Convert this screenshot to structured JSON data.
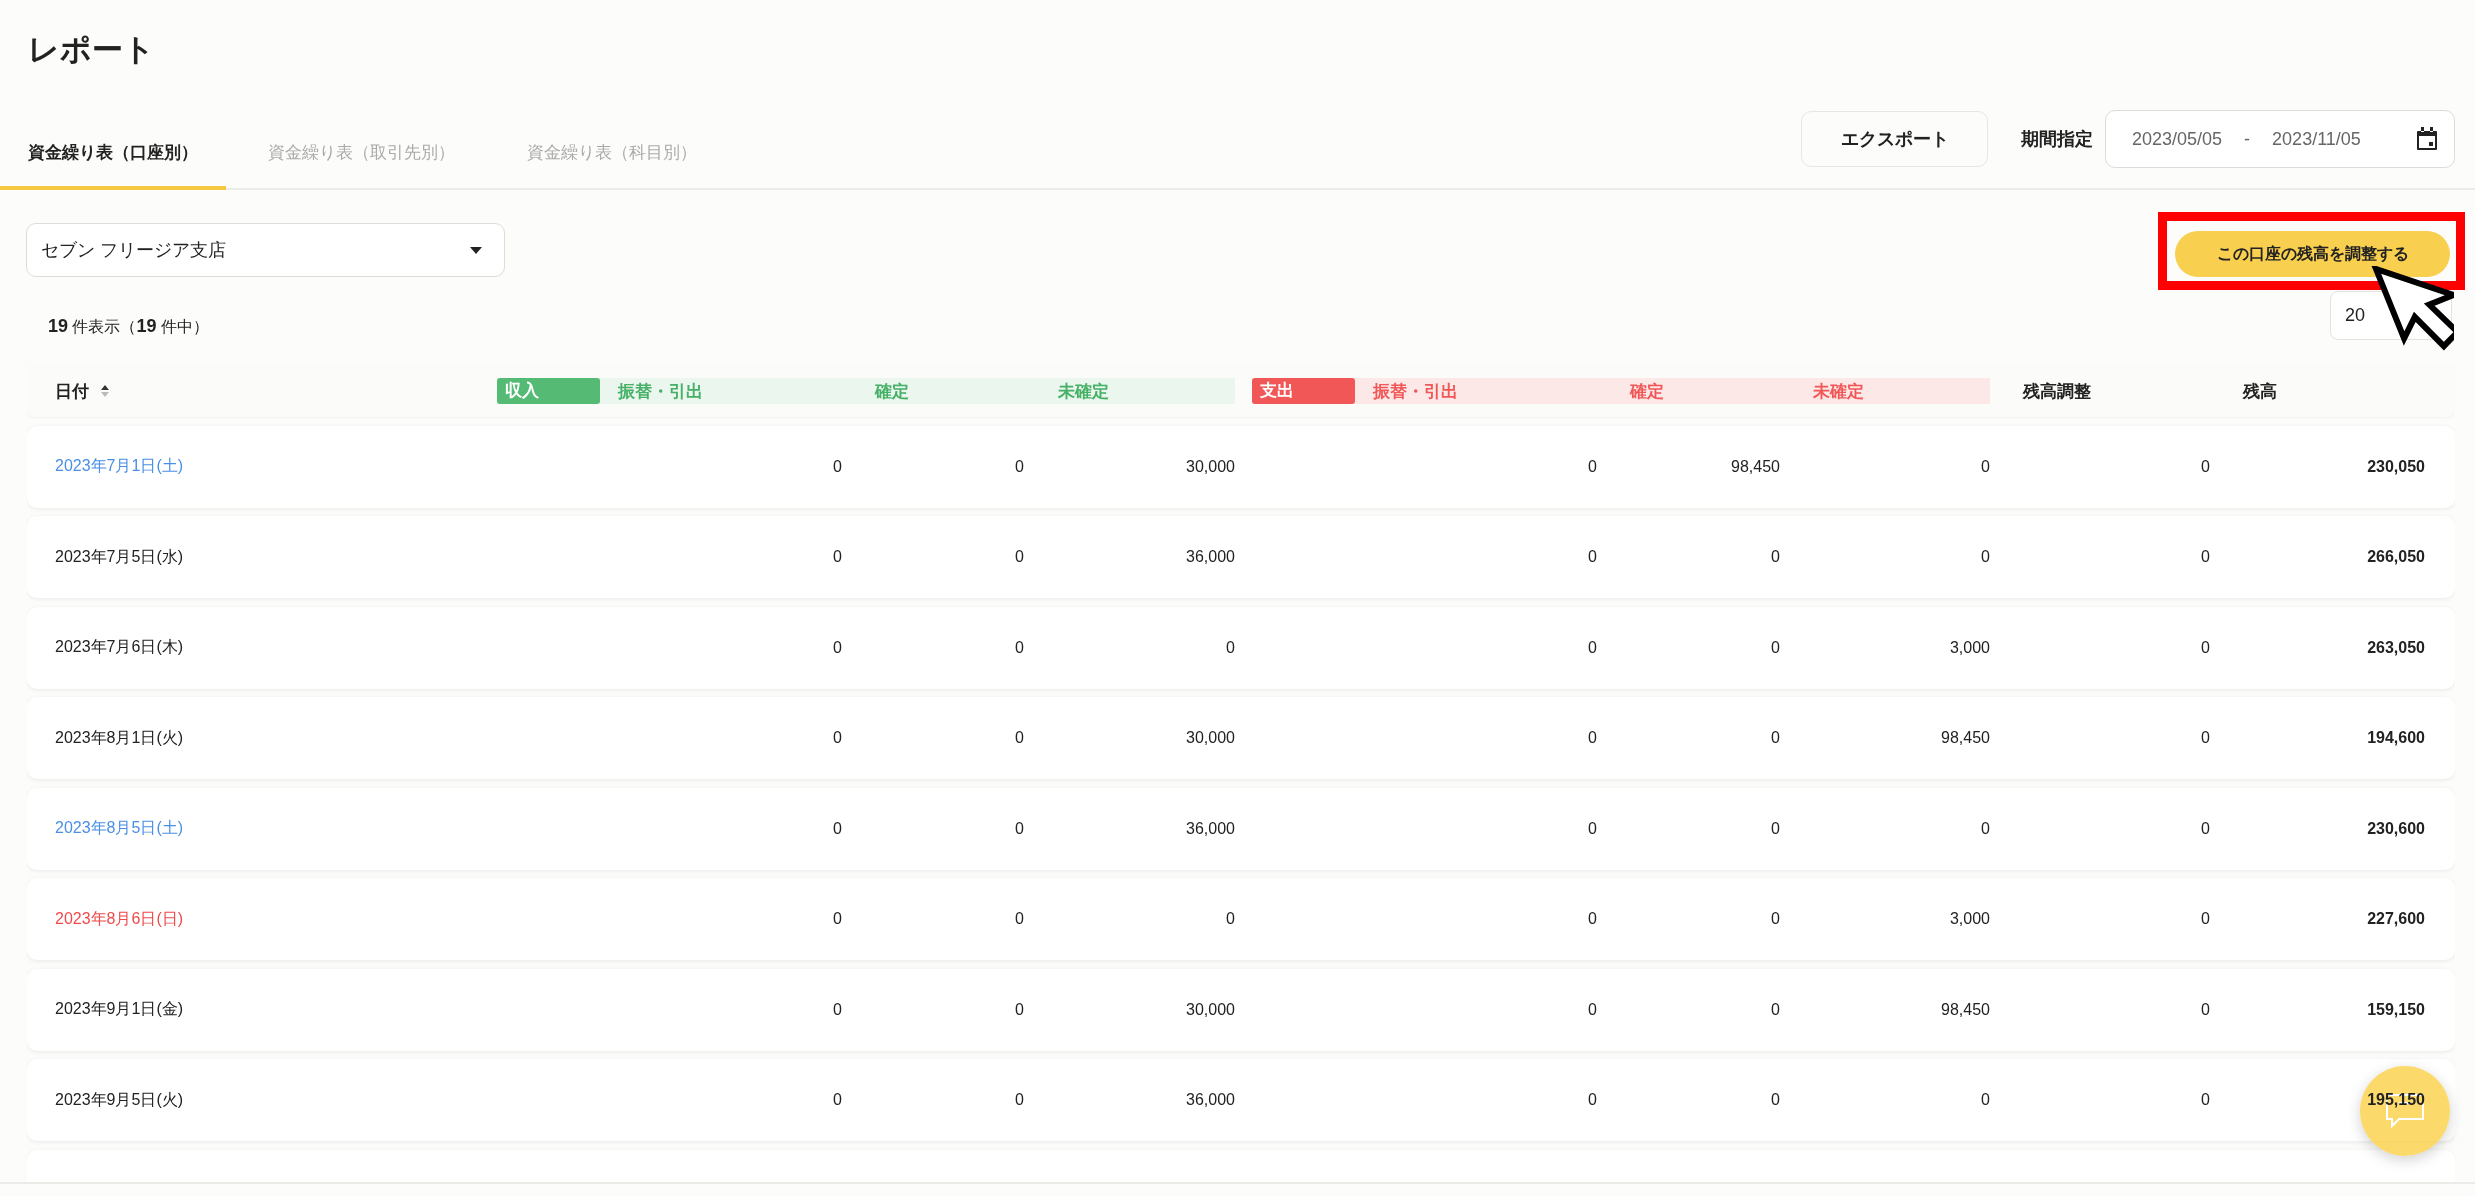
{
  "page": {
    "title": "レポート"
  },
  "tabs": [
    {
      "label": "資金繰り表（口座別）",
      "selected": true
    },
    {
      "label": "資金繰り表（取引先別）",
      "selected": false
    },
    {
      "label": "資金繰り表（科目別）",
      "selected": false
    }
  ],
  "export_button": "エクスポート",
  "period": {
    "label": "期間指定",
    "start": "2023/05/05",
    "separator": "-",
    "end": "2023/11/05"
  },
  "account_select": {
    "value": "セブン フリージア支店"
  },
  "adjust_button": "この口座の残高を調整する",
  "page_size_field": {
    "value": "20"
  },
  "result_count": "**19** 件表示（**19** 件中）",
  "table": {
    "date_column": {
      "label": "日付",
      "sort_ascending": true
    },
    "groups": [
      {
        "kind": "income",
        "badge": "収入",
        "columns": [
          "振替・引出",
          "確定",
          "未確定"
        ]
      },
      {
        "kind": "expense",
        "badge": "支出",
        "columns": [
          "振替・引出",
          "確定",
          "未確定"
        ]
      }
    ],
    "columns": [
      "残高調整",
      "残高"
    ],
    "rows": [
      {
        "date": "2023年7月1日(土)",
        "kind": "saturday",
        "values": [
          "0",
          "0",
          "30,000",
          "0",
          "98,450",
          "0",
          "0",
          "230,050"
        ]
      },
      {
        "date": "2023年7月5日(水)",
        "kind": "weekday",
        "values": [
          "0",
          "0",
          "36,000",
          "0",
          "0",
          "0",
          "0",
          "266,050"
        ]
      },
      {
        "date": "2023年7月6日(木)",
        "kind": "weekday",
        "values": [
          "0",
          "0",
          "0",
          "0",
          "0",
          "3,000",
          "0",
          "263,050"
        ]
      },
      {
        "date": "2023年8月1日(火)",
        "kind": "weekday",
        "values": [
          "0",
          "0",
          "30,000",
          "0",
          "0",
          "98,450",
          "0",
          "194,600"
        ]
      },
      {
        "date": "2023年8月5日(土)",
        "kind": "saturday",
        "values": [
          "0",
          "0",
          "36,000",
          "0",
          "0",
          "0",
          "0",
          "230,600"
        ]
      },
      {
        "date": "2023年8月6日(日)",
        "kind": "sunday",
        "values": [
          "0",
          "0",
          "0",
          "0",
          "0",
          "3,000",
          "0",
          "227,600"
        ]
      },
      {
        "date": "2023年9月1日(金)",
        "kind": "weekday",
        "values": [
          "0",
          "0",
          "30,000",
          "0",
          "0",
          "98,450",
          "0",
          "159,150"
        ]
      },
      {
        "date": "2023年9月5日(火)",
        "kind": "weekday",
        "values": [
          "0",
          "0",
          "36,000",
          "0",
          "0",
          "0",
          "0",
          "195,150"
        ]
      }
    ]
  }
}
